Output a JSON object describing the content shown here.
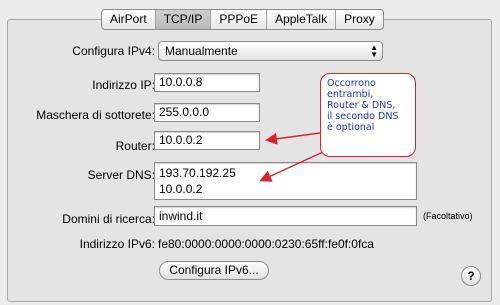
{
  "tabs": [
    {
      "label": "AirPort"
    },
    {
      "label": "TCP/IP"
    },
    {
      "label": "PPPoE"
    },
    {
      "label": "AppleTalk"
    },
    {
      "label": "Proxy"
    }
  ],
  "configure": {
    "label": "Configura IPv4:",
    "value": "Manualmente"
  },
  "ip": {
    "label": "Indirizzo IP:",
    "value": "10.0.0.8"
  },
  "mask": {
    "label": "Maschera di sottorete:",
    "value": "255.0.0.0"
  },
  "router": {
    "label": "Router:",
    "value": "10.0.0.2"
  },
  "dns": {
    "label": "Server DNS:",
    "line1": "193.70.192.25",
    "line2": "10.0.0.2"
  },
  "search": {
    "label": "Domini di ricerca:",
    "value": "inwind.it",
    "optional": "(Facoltativo)"
  },
  "ipv6": {
    "label": "Indirizzo IPv6:",
    "value": "fe80:0000:0000:0000:0230:65ff:fe0f:0fca"
  },
  "ipv6_button": "Configura IPv6...",
  "help": "?",
  "annotation": {
    "lines": [
      "Occorrono",
      "entrambi,",
      "Router & DNS,",
      "il secondo DNS",
      "è optional"
    ],
    "text_color": "#1834c6",
    "border_color": "#d9252a"
  }
}
